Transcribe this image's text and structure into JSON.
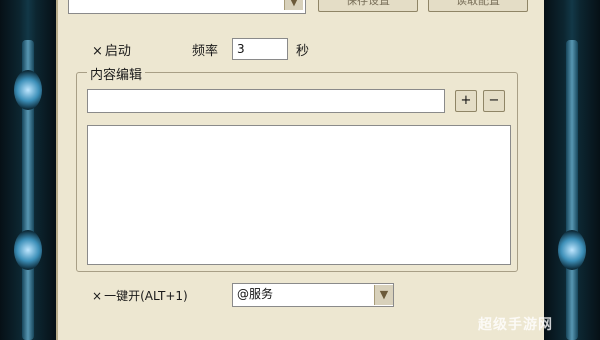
{
  "top_row": {
    "button1_label": "保存设置",
    "button2_label": "读取配置"
  },
  "startup": {
    "check_mark": "×",
    "label": "启动"
  },
  "frequency": {
    "label": "频率",
    "value": "3",
    "unit": "秒"
  },
  "content_group": {
    "title": "内容编辑",
    "line_value": "",
    "add_label": "+",
    "remove_label": "−",
    "text_area_value": ""
  },
  "one_key": {
    "check_mark": "×",
    "label": "一键开(ALT+1)"
  },
  "service_select": {
    "value": "@服务"
  },
  "watermark": "超级手游网",
  "icons": {
    "dropdown": "arrow-down-icon"
  }
}
